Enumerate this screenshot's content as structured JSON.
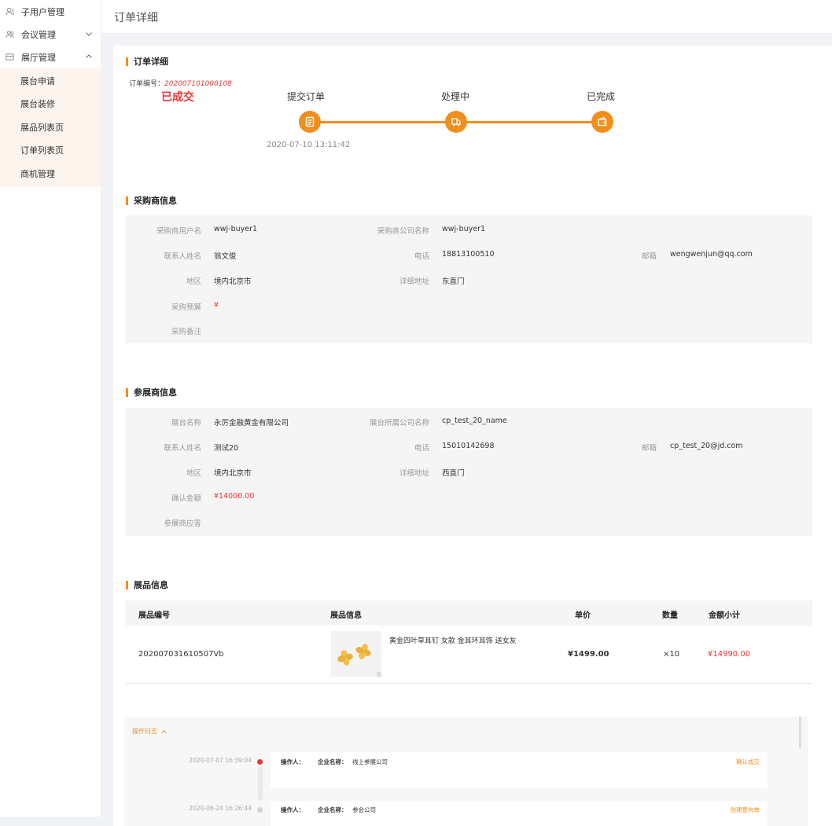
{
  "sidebar": {
    "items": [
      {
        "label": "子用户管理",
        "icon": "users-icon"
      },
      {
        "label": "会议管理",
        "icon": "group-icon",
        "chevron": "down"
      },
      {
        "label": "展厅管理",
        "icon": "hall-icon",
        "chevron": "up"
      }
    ],
    "submenu": [
      "展台申请",
      "展台装修",
      "展品列表页",
      "订单列表页",
      "商机管理"
    ]
  },
  "header": {
    "title": "订单详细"
  },
  "order": {
    "section_title": "订单详细",
    "number_label": "订单编号：",
    "number": "202007101000108",
    "status": "已成交",
    "steps": [
      "提交订单",
      "处理中",
      "已完成"
    ],
    "submit_time": "2020-07-10 13:11:42"
  },
  "buyer": {
    "section_title": "采购商信息",
    "username_label": "采购商用户名",
    "username": "wwj-buyer1",
    "company_label": "采购商公司名称",
    "company": "wwj-buyer1",
    "contact_label": "联系人姓名",
    "contact": "翁文俊",
    "phone_label": "电话",
    "phone": "18813100510",
    "email_label": "邮箱",
    "email": "wengwenjun@qq.com",
    "region_label": "地区",
    "region": "境内北京市",
    "address_label": "详细地址",
    "address": "东直门",
    "budget_label": "采购预算",
    "budget": "¥",
    "remark_label": "采购备注",
    "remark": ""
  },
  "exhibitor": {
    "section_title": "参展商信息",
    "booth_label": "展台名称",
    "booth": "永厉金融黄金有限公司",
    "company_label": "展台所属公司名称",
    "company": "cp_test_20_name",
    "contact_label": "联系人姓名",
    "contact": "测试20",
    "phone_label": "电话",
    "phone": "15010142698",
    "email_label": "邮箱",
    "email": "cp_test_20@jd.com",
    "region_label": "地区",
    "region": "境内北京市",
    "address_label": "详细地址",
    "address": "西直门",
    "amount_label": "确认金额",
    "amount": "¥14000.00",
    "reply_label": "参展商应答",
    "reply": ""
  },
  "products": {
    "section_title": "展品信息",
    "columns": [
      "展品编号",
      "展品信息",
      "单价",
      "数量",
      "金额小计"
    ],
    "rows": [
      {
        "id": "202007031610507Vb",
        "name": "黄金四叶草耳钉 女款 金耳环耳饰 送女友",
        "price": "¥1499.00",
        "qty": "×10",
        "subtotal": "¥14990.00"
      }
    ]
  },
  "log": {
    "toggle_label": "操作日志",
    "entries": [
      {
        "time": "2020-07-07 16:39:04",
        "operator_label": "操作人：",
        "company_label": "企业名称：",
        "company": "线上参展公司",
        "action": "确认成交",
        "active": true
      },
      {
        "time": "2020-06-24 16:26:44",
        "operator_label": "操作人：",
        "company_label": "企业名称：",
        "company": "参会公司",
        "action": "创建意向单",
        "active": false
      }
    ]
  },
  "colors": {
    "accent": "#f18f1c",
    "danger": "#e53935",
    "panel": "#f5f5f5"
  }
}
